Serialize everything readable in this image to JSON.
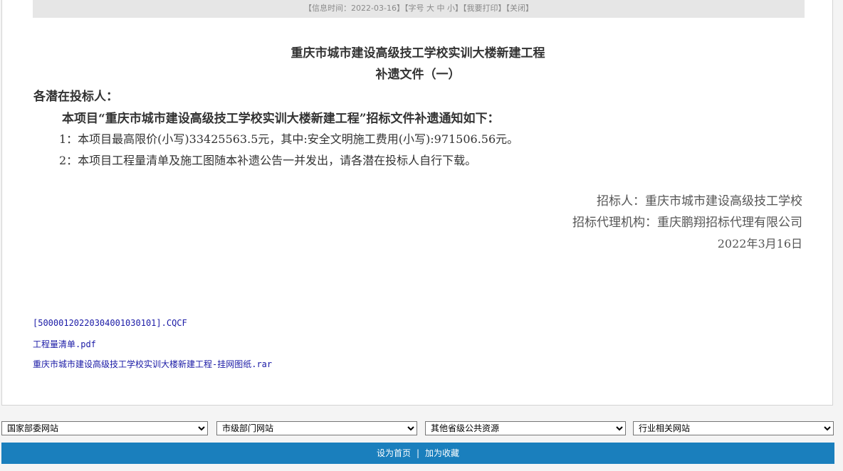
{
  "info_bar": {
    "time_label": "【信息时间：2022-03-16】",
    "font_label": "【字号 ",
    "font_large": "大",
    "font_medium": "中",
    "font_small": "小",
    "font_end": "】",
    "print_label": "【我要打印】",
    "close_label": "【关闭】"
  },
  "document": {
    "title": "重庆市城市建设高级技工学校实训大楼新建工程",
    "subtitle": "补遗文件（一）",
    "salutation": "各潜在投标人：",
    "notice": "本项目“重庆市城市建设高级技工学校实训大楼新建工程”招标文件补遗通知如下：",
    "items": [
      "1：本项目最高限价(小写)33425563.5元，其中:安全文明施工费用(小写):971506.56元。",
      "2：本项目工程量清单及施工图随本补遗公告一并发出，请各潜在投标人自行下载。"
    ],
    "signature": {
      "tenderer": "招标人：重庆市城市建设高级技工学校",
      "agency": "招标代理机构：重庆鹏翔招标代理有限公司",
      "date": "2022年3月16日"
    }
  },
  "attachments": [
    "[500001202203040010301​01].CQCF",
    "工程量清单.pdf",
    "重庆市城市建设高级技工学校实训大楼新建工程-挂网图纸.rar"
  ],
  "link_selects": [
    "国家部委网站",
    "市级部门网站",
    "其他省级公共资源",
    "行业相关网站"
  ],
  "footer": {
    "set_home": "设为首页",
    "separator": "|",
    "add_favorite": "加为收藏"
  }
}
